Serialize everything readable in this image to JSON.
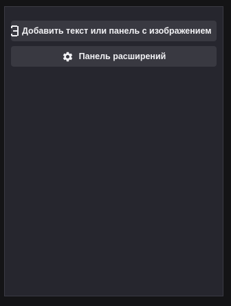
{
  "panel": {
    "add_button": {
      "label": "Добавить текст или панель с изображением",
      "icon": "add-panel-icon"
    },
    "extensions_button": {
      "label": "Панель расширений",
      "icon": "gear-icon"
    }
  }
}
